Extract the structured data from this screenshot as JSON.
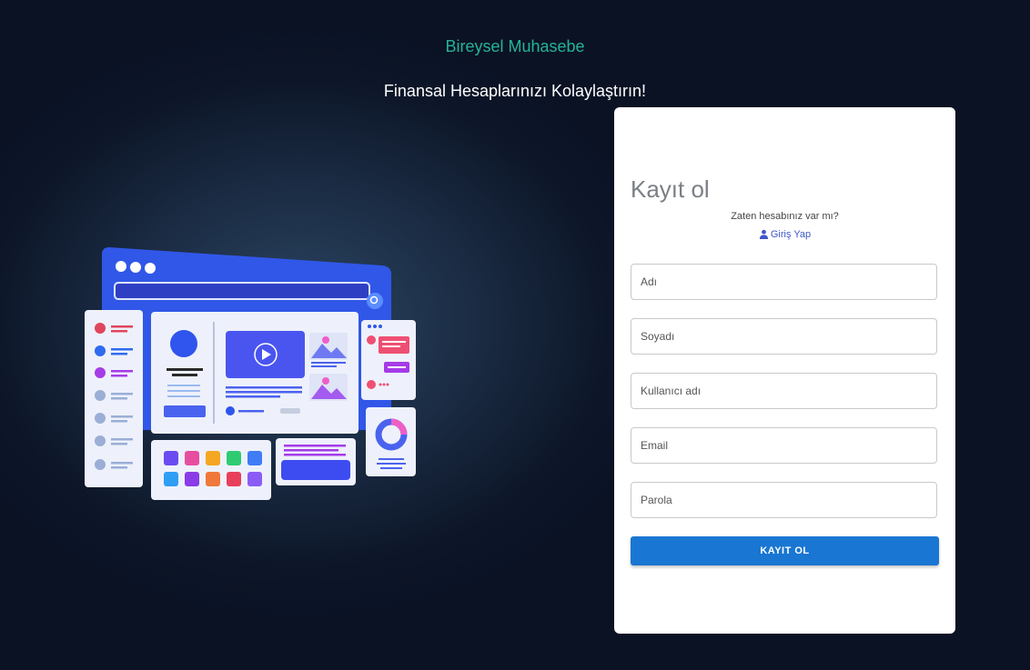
{
  "header": {
    "brand": "Bireysel Muhasebe",
    "tagline": "Finansal Hesaplarınızı Kolaylaştırın!"
  },
  "illustration": {
    "icon": "web-dashboard-illustration"
  },
  "form": {
    "title": "Kayıt ol",
    "already_text": "Zaten hesabınız var mı?",
    "login_link": "Giriş Yap",
    "login_icon": "person-icon",
    "fields": {
      "first_name": {
        "placeholder": "Adı"
      },
      "last_name": {
        "placeholder": "Soyadı"
      },
      "username": {
        "placeholder": "Kullanıcı adı"
      },
      "email": {
        "placeholder": "Email"
      },
      "password": {
        "placeholder": "Parola"
      }
    },
    "submit_label": "KAYIT OL"
  },
  "colors": {
    "brand": "#26b396",
    "primary_button": "#1976d2",
    "link": "#3f57c9"
  }
}
